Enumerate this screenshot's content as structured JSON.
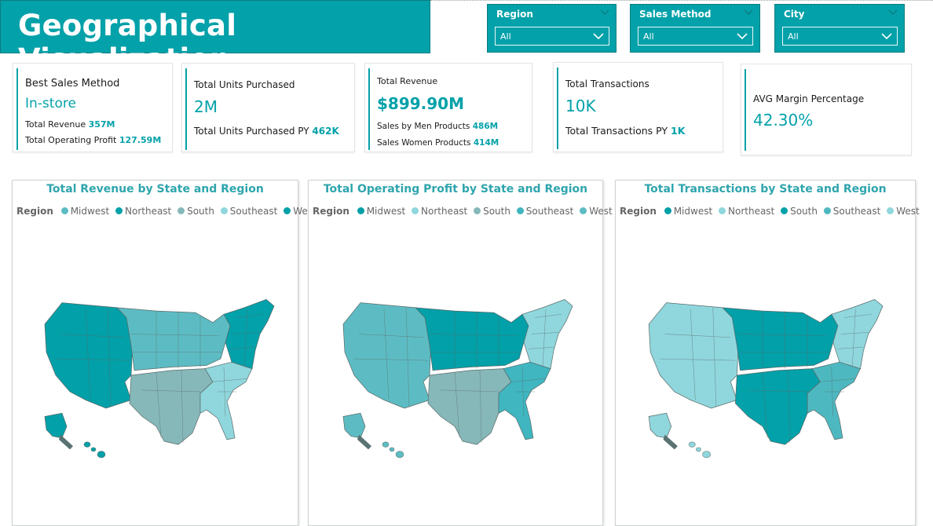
{
  "header": {
    "title": "Geographical Visualization"
  },
  "filters": [
    {
      "label": "Region",
      "value": "All"
    },
    {
      "label": "Sales Method",
      "value": "All"
    },
    {
      "label": "City",
      "value": "All"
    }
  ],
  "cards": {
    "best_method": {
      "title": "Best Sales Method",
      "value": "In-store",
      "revenue_label": "Total Revenue",
      "revenue_value": "357M",
      "profit_label": "Total Operating Profit",
      "profit_value": "127.59M"
    },
    "units": {
      "title": "Total Units Purchased",
      "value": "2M",
      "py_label": "Total Units Purchased PY",
      "py_value": "462K"
    },
    "revenue": {
      "title": "Total Revenue",
      "value": "$899.90M",
      "men_label": "Sales by Men Products",
      "men_value": "486M",
      "women_label": "Sales Women Products",
      "women_value": "414M"
    },
    "transactions": {
      "title": "Total Transactions",
      "value": "10K",
      "py_label": "Total Transactions PY",
      "py_value": "1K"
    },
    "margin": {
      "title": "AVG Margin Percentage",
      "value": "42.30%"
    }
  },
  "maps": [
    {
      "title": "Total Revenue by State and Region",
      "legend_title": "Region",
      "legend": [
        {
          "name": "Midwest",
          "color": "#5dbcc3"
        },
        {
          "name": "Northeast",
          "color": "#03a1a9"
        },
        {
          "name": "South",
          "color": "#86b8b9"
        },
        {
          "name": "Southeast",
          "color": "#8fd7dd"
        },
        {
          "name": "West",
          "color": "#02a0a8"
        }
      ],
      "region_colors": {
        "West": "#02a0a8",
        "Midwest": "#5dbcc3",
        "South": "#86b8b9",
        "Southeast": "#8fd7dd",
        "Northeast": "#03a1a9"
      }
    },
    {
      "title": "Total Operating Profit by State and Region",
      "legend_title": "Region",
      "legend": [
        {
          "name": "Midwest",
          "color": "#02a0a8"
        },
        {
          "name": "Northeast",
          "color": "#8fd7dd"
        },
        {
          "name": "South",
          "color": "#86b8b9"
        },
        {
          "name": "Southeast",
          "color": "#3fb6c0"
        },
        {
          "name": "West",
          "color": "#5dbcc3"
        }
      ],
      "region_colors": {
        "West": "#5dbcc3",
        "Midwest": "#02a0a8",
        "South": "#86b8b9",
        "Southeast": "#3fb6c0",
        "Northeast": "#8fd7dd"
      }
    },
    {
      "title": "Total Transactions by State and Region",
      "legend_title": "Region",
      "legend": [
        {
          "name": "Midwest",
          "color": "#02a0a8"
        },
        {
          "name": "Northeast",
          "color": "#8fd7dd"
        },
        {
          "name": "South",
          "color": "#03a1a9"
        },
        {
          "name": "Southeast",
          "color": "#4eb8c0"
        },
        {
          "name": "West",
          "color": "#8fd7dd"
        }
      ],
      "region_colors": {
        "West": "#8fd7dd",
        "Midwest": "#02a0a8",
        "South": "#03a1a9",
        "Southeast": "#4eb8c0",
        "Northeast": "#8fd7dd"
      }
    }
  ]
}
